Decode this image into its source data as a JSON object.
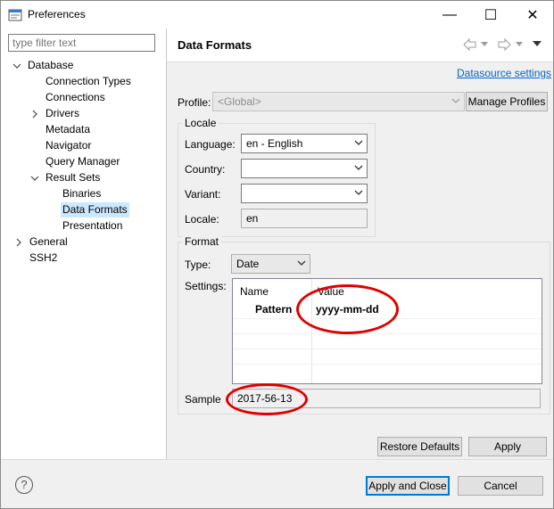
{
  "window": {
    "title": "Preferences",
    "controls": {
      "minimize": "—",
      "maximize": "☐",
      "close": "✕"
    }
  },
  "sidebar": {
    "filter_placeholder": "type filter text",
    "items": [
      {
        "label": "Database"
      },
      {
        "label": "Connection Types"
      },
      {
        "label": "Connections"
      },
      {
        "label": "Drivers"
      },
      {
        "label": "Metadata"
      },
      {
        "label": "Navigator"
      },
      {
        "label": "Query Manager"
      },
      {
        "label": "Result Sets"
      },
      {
        "label": "Binaries"
      },
      {
        "label": "Data Formats",
        "selected": true
      },
      {
        "label": "Presentation"
      },
      {
        "label": "General"
      },
      {
        "label": "SSH2"
      }
    ]
  },
  "page": {
    "title": "Data Formats",
    "datasource_link": "Datasource settings",
    "profile_label": "Profile:",
    "profile_value": "<Global>",
    "manage_profiles": "Manage Profiles",
    "locale": {
      "title": "Locale",
      "language_label": "Language:",
      "language_value": "en - English",
      "country_label": "Country:",
      "country_value": "",
      "variant_label": "Variant:",
      "variant_value": "",
      "locale_label": "Locale:",
      "locale_value": "en"
    },
    "format": {
      "title": "Format",
      "type_label": "Type:",
      "type_value": "Date",
      "settings_label": "Settings:",
      "columns": [
        "Name",
        "Value"
      ],
      "rows": [
        {
          "name": "Pattern",
          "value": "yyyy-mm-dd"
        }
      ],
      "sample_label": "Sample",
      "sample_value": "2017-56-13"
    },
    "restore_defaults": "Restore Defaults",
    "apply": "Apply"
  },
  "footer": {
    "help": "?",
    "apply_close": "Apply and Close",
    "cancel": "Cancel"
  },
  "annotation_color": "#e10000"
}
